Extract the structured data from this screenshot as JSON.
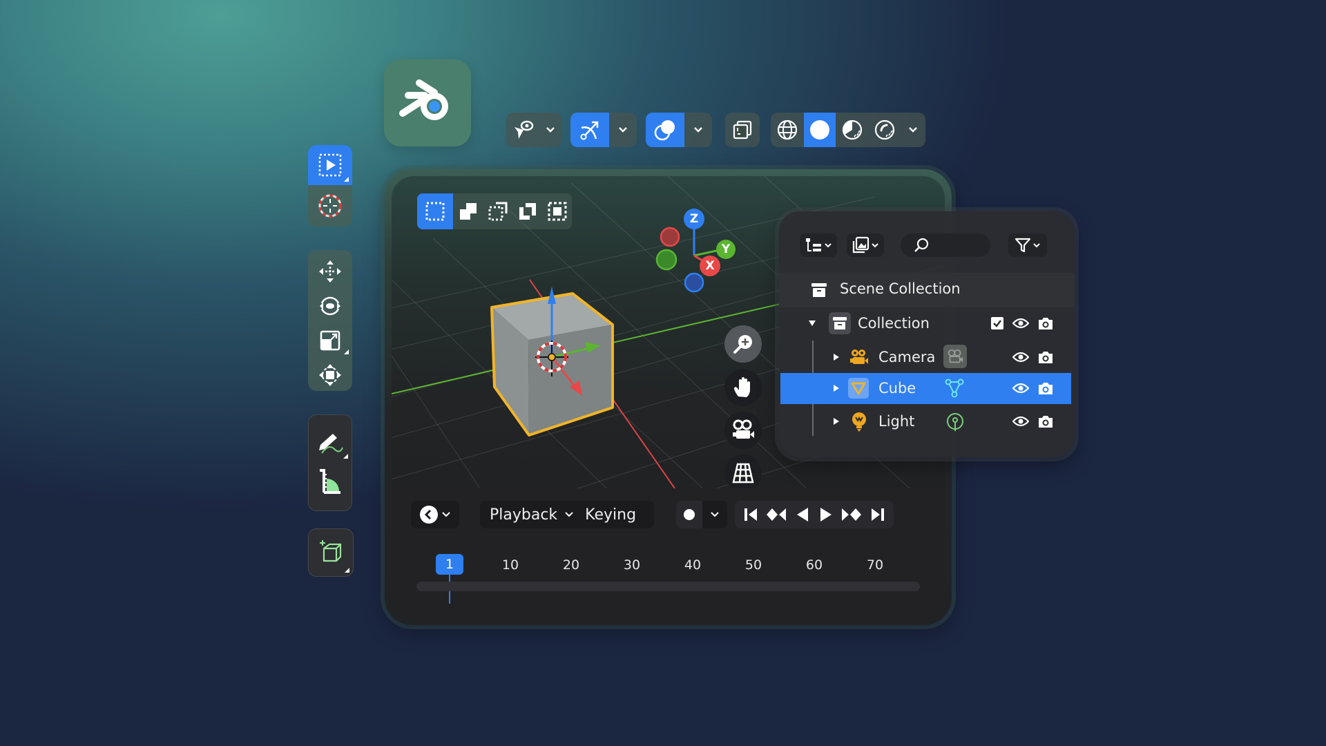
{
  "app": {
    "name": "Blender",
    "logo_icon": "blender-logo-icon"
  },
  "colors": {
    "accent": "#2f7ff0",
    "selection_outline": "#f0b429",
    "x_axis": "#e84848",
    "y_axis": "#5cb531",
    "z_axis": "#2f7ff0",
    "background": "#1b2641"
  },
  "header_toolbar": {
    "groups": [
      {
        "icon": "object-interaction-icon",
        "has_dropdown": true,
        "active": false
      },
      {
        "icon": "transform-pivot-icon",
        "has_dropdown": true,
        "active": true
      },
      {
        "icon": "overlays-icon",
        "has_dropdown": true,
        "active": true
      },
      {
        "icon": "xray-toggle-icon",
        "has_dropdown": false,
        "active": false
      },
      {
        "icon": "shading-modes",
        "items": [
          "wireframe-icon",
          "solid-icon",
          "material-preview-icon",
          "rendered-icon"
        ],
        "active_item": "solid-icon",
        "has_dropdown": true
      }
    ]
  },
  "left_toolbar": {
    "groups": [
      {
        "tools": [
          "select-box-icon",
          "cursor-icon"
        ],
        "active": "select-box-icon"
      },
      {
        "tools": [
          "move-icon",
          "rotate-icon",
          "scale-icon",
          "transform-icon"
        ]
      },
      {
        "tools": [
          "annotate-icon",
          "measure-icon"
        ]
      },
      {
        "tools": [
          "add-cube-icon"
        ]
      }
    ]
  },
  "viewport": {
    "selection_modes": [
      "set-new-selection-icon",
      "extend-selection-icon",
      "subtract-selection-icon",
      "invert-selection-icon",
      "intersect-selection-icon"
    ],
    "active_selection_mode": "set-new-selection-icon",
    "gizmo": {
      "x_label": "X",
      "y_label": "Y",
      "z_label": "Z"
    },
    "nav_buttons": [
      "zoom-icon",
      "pan-hand-icon",
      "camera-view-icon",
      "ortho-grid-icon"
    ],
    "selected_object": "Cube"
  },
  "timeline": {
    "editor_type_icon": "clock-icon",
    "playback_label": "Playback",
    "keying_label": "Keying",
    "record_icon": "record-icon",
    "transport": [
      "jump-start-icon",
      "prev-keyframe-icon",
      "play-reverse-icon",
      "play-icon",
      "next-keyframe-icon",
      "jump-end-icon"
    ],
    "current_frame": "1",
    "frame_labels": [
      "10",
      "20",
      "30",
      "40",
      "50",
      "60",
      "70"
    ]
  },
  "outliner": {
    "header": {
      "display_mode_icon": "outliner-tree-icon",
      "view_layer_icon": "view-layer-icon",
      "search_placeholder": "",
      "filter_icon": "filter-icon"
    },
    "scene_collection": "Scene Collection",
    "collection": {
      "name": "Collection",
      "checked": true,
      "expanded": true
    },
    "items": [
      {
        "name": "Camera",
        "type_icon": "camera-object-icon",
        "data_icon": "camera-data-icon",
        "selected": false
      },
      {
        "name": "Cube",
        "type_icon": "mesh-object-icon",
        "data_icon": "mesh-data-icon",
        "selected": true
      },
      {
        "name": "Light",
        "type_icon": "light-object-icon",
        "data_icon": "light-data-icon",
        "selected": false
      }
    ]
  }
}
